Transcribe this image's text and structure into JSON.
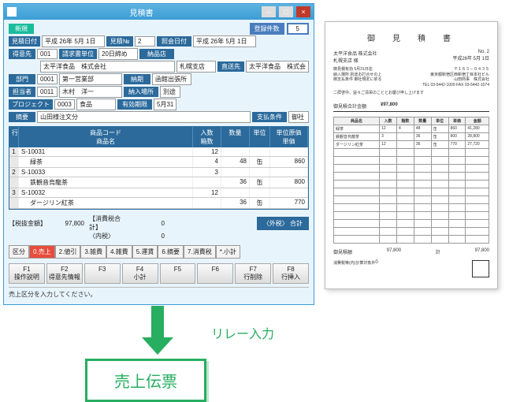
{
  "window": {
    "title": "見積書",
    "btns": {
      "min": "–",
      "max": "□",
      "close": "×"
    }
  },
  "header": {
    "new_tag": "新規",
    "register": {
      "label": "登録件数",
      "value": "5"
    },
    "date": {
      "label": "見積日付",
      "value": "平成 26年 5月 1日"
    },
    "slip_no": {
      "label": "見積№",
      "value": "2"
    },
    "ref_date": {
      "label": "照会日付",
      "value": "平成 26年 5月 1日"
    },
    "req_unit": {
      "label": "請求書単位",
      "value": "20日締め"
    },
    "customer": {
      "label": "得意先",
      "code": "001",
      "name": "太平洋食品　株式会社"
    },
    "ship_store": {
      "label": "納品店",
      "value": "札幌支店"
    },
    "direct": {
      "label": "直送先",
      "value": "太平洋食品　株式会"
    },
    "dept": {
      "label": "部門",
      "code": "0001",
      "name": "第一営業部"
    },
    "staff": {
      "label": "担当者",
      "code": "0011",
      "name": "木村　洋一"
    },
    "delivery_note": {
      "label": "納期",
      "value": "函館出張所"
    },
    "project": {
      "label": "プロジェクト",
      "code": "0003",
      "name": "食品"
    },
    "place": {
      "label": "納入場所",
      "value": "別途"
    },
    "subject": {
      "label": "摘要",
      "value": "山田様注文分"
    },
    "valid": {
      "label": "有効期限",
      "value": "5月31"
    },
    "pay": {
      "label": "支払条件",
      "value": "御社"
    }
  },
  "grid": {
    "head": {
      "idx": "行",
      "code1": "商品コード",
      "code2": "商品名",
      "q1a": "入数",
      "q1b": "箱数",
      "q2": "数量",
      "unit": "単位",
      "p1": "単位原価",
      "p2": "単価"
    },
    "rows": [
      {
        "idx": "1",
        "code": "S-10031",
        "name": "緑茶",
        "q1": "12",
        "box": "4",
        "q2": "48",
        "unit": "缶",
        "price": "860"
      },
      {
        "idx": "2",
        "code": "S-10033",
        "name": "鉄観音烏龍茶",
        "q1": "3",
        "box": "",
        "q2": "36",
        "unit": "缶",
        "price": "800"
      },
      {
        "idx": "3",
        "code": "S-10032",
        "name": "ダージリン紅茶",
        "q1": "12",
        "box": "",
        "q2": "36",
        "unit": "缶",
        "price": "770"
      }
    ]
  },
  "totals": {
    "pretax_label": "【税抜金額】",
    "pretax": "97,800",
    "tax_label": "【消費税合計】",
    "tax": "0",
    "inner_label": "〈内税〉",
    "inner": "0",
    "btn": "〈外税〉\n合計"
  },
  "segment": {
    "label": "区分",
    "items": [
      "0.売上",
      "2.値引",
      "3.雑費",
      "4.雑費",
      "5.運賃",
      "6.摘要",
      "7.消費税",
      "*.小計"
    ]
  },
  "fkeys": [
    {
      "k": "F1",
      "t": "操作説明"
    },
    {
      "k": "F2",
      "t": "得意先情報"
    },
    {
      "k": "F3",
      "t": ""
    },
    {
      "k": "F4",
      "t": "小計"
    },
    {
      "k": "F5",
      "t": ""
    },
    {
      "k": "F6",
      "t": ""
    },
    {
      "k": "F7",
      "t": "行削除"
    },
    {
      "k": "F8",
      "t": "行挿入"
    }
  ],
  "status": "売上区分を入力してください。",
  "doc": {
    "title": "御　見　積　書",
    "to": "太平洋食品 株式会社\n札幌支店 様",
    "no": "No.    2",
    "date": "平成26年 5月 1日",
    "from_addr": "〒１６３－０４３５\n東京都新宿区西新宿丁目本社ビル\n山田商事　株式会社\nTEL 03-5442-1000  FAX 03-5442-1074",
    "greet": "二拝啓中、益々ご清栄のこととお慶び申し上げます",
    "lines": [
      {
        "l": "御見積有効",
        "v": "5月31日迄"
      },
      {
        "l": "納入場所",
        "v": "別途お打合せの上"
      },
      {
        "l": "御支払条件",
        "v": "御社規定に依る"
      }
    ],
    "total_label": "御見積合計金額",
    "total": "¥97,800",
    "thead": [
      "商品名",
      "入数",
      "箱数",
      "数量",
      "単位",
      "単価",
      "金額"
    ],
    "trows": [
      [
        "緑茶",
        "12",
        "4",
        "48",
        "缶",
        "860",
        "41,280"
      ],
      [
        "鉄観音烏龍茶",
        "3",
        "",
        "36",
        "缶",
        "800",
        "28,800"
      ],
      [
        "ダージリン紅茶",
        "12",
        "",
        "36",
        "缶",
        "770",
        "27,720"
      ]
    ],
    "empty_rows": 12,
    "foot": {
      "pretax_l": "御見積額",
      "pretax": "97,800",
      "tax_l": "消費税等(内)計算対象外",
      "tax": "0",
      "total_l": "計",
      "total": "97,800"
    }
  },
  "relay_label": "リレー入力",
  "callout": "売上伝票"
}
